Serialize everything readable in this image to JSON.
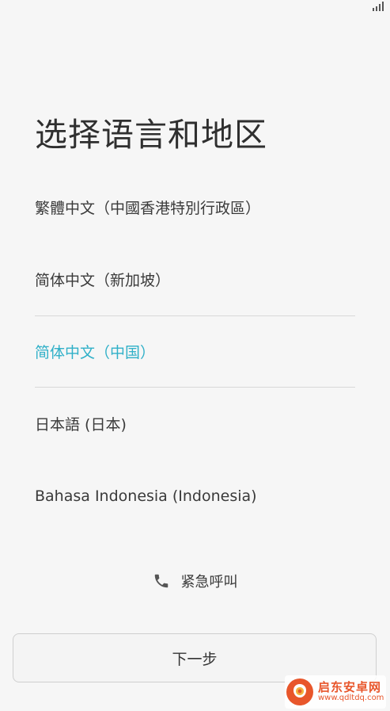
{
  "page": {
    "title": "选择语言和地区"
  },
  "languages": [
    {
      "label": "繁體中文（中國香港特別行政區）",
      "selected": false
    },
    {
      "label": "简体中文（新加坡）",
      "selected": false
    },
    {
      "label": "简体中文（中国）",
      "selected": true
    },
    {
      "label": "日本語 (日本)",
      "selected": false
    },
    {
      "label": "Bahasa Indonesia (Indonesia)",
      "selected": false
    }
  ],
  "emergency": {
    "label": "紧急呼叫",
    "icon": "phone-icon"
  },
  "footer": {
    "next_label": "下一步"
  },
  "status_bar": {
    "icon": "signal-icon"
  },
  "watermark": {
    "title": "启东安卓网",
    "url": "www.qdltdq.com"
  },
  "colors": {
    "background": "#f6f6f6",
    "accent": "#30b0c8",
    "text": "#333333",
    "divider": "#d9d9d9",
    "watermark": "#e8562b"
  }
}
